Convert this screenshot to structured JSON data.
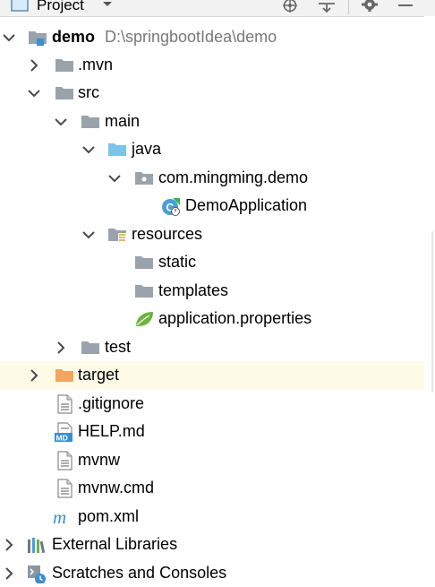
{
  "panel": {
    "title": "Project",
    "icons": [
      "project-view-icon",
      "dropdown-icon",
      "locate-icon",
      "collapse-all-icon",
      "settings-icon",
      "hide-icon"
    ]
  },
  "tree": {
    "root": {
      "label": "demo",
      "path": "D:\\springbootIdea\\demo"
    },
    "mvn": ".mvn",
    "src": "src",
    "main": "main",
    "java": "java",
    "package": "com.mingming.demo",
    "app_class": "DemoApplication",
    "resources": "resources",
    "static": "static",
    "templates": "templates",
    "app_props": "application.properties",
    "test": "test",
    "target": "target",
    "gitignore": ".gitignore",
    "help": "HELP.md",
    "help_badge": "MD",
    "mvnw": "mvnw",
    "mvnw_cmd": "mvnw.cmd",
    "pom": "pom.xml",
    "pom_badge": "m",
    "ext_libs": "External Libraries",
    "scratches": "Scratches and Consoles"
  },
  "colors": {
    "folder_gray": "#9aa3ab",
    "folder_blue": "#7cc3e8",
    "folder_orange": "#f4a460",
    "highlight_row": "#fdfbe6",
    "arrow": "#4a4a4a"
  }
}
